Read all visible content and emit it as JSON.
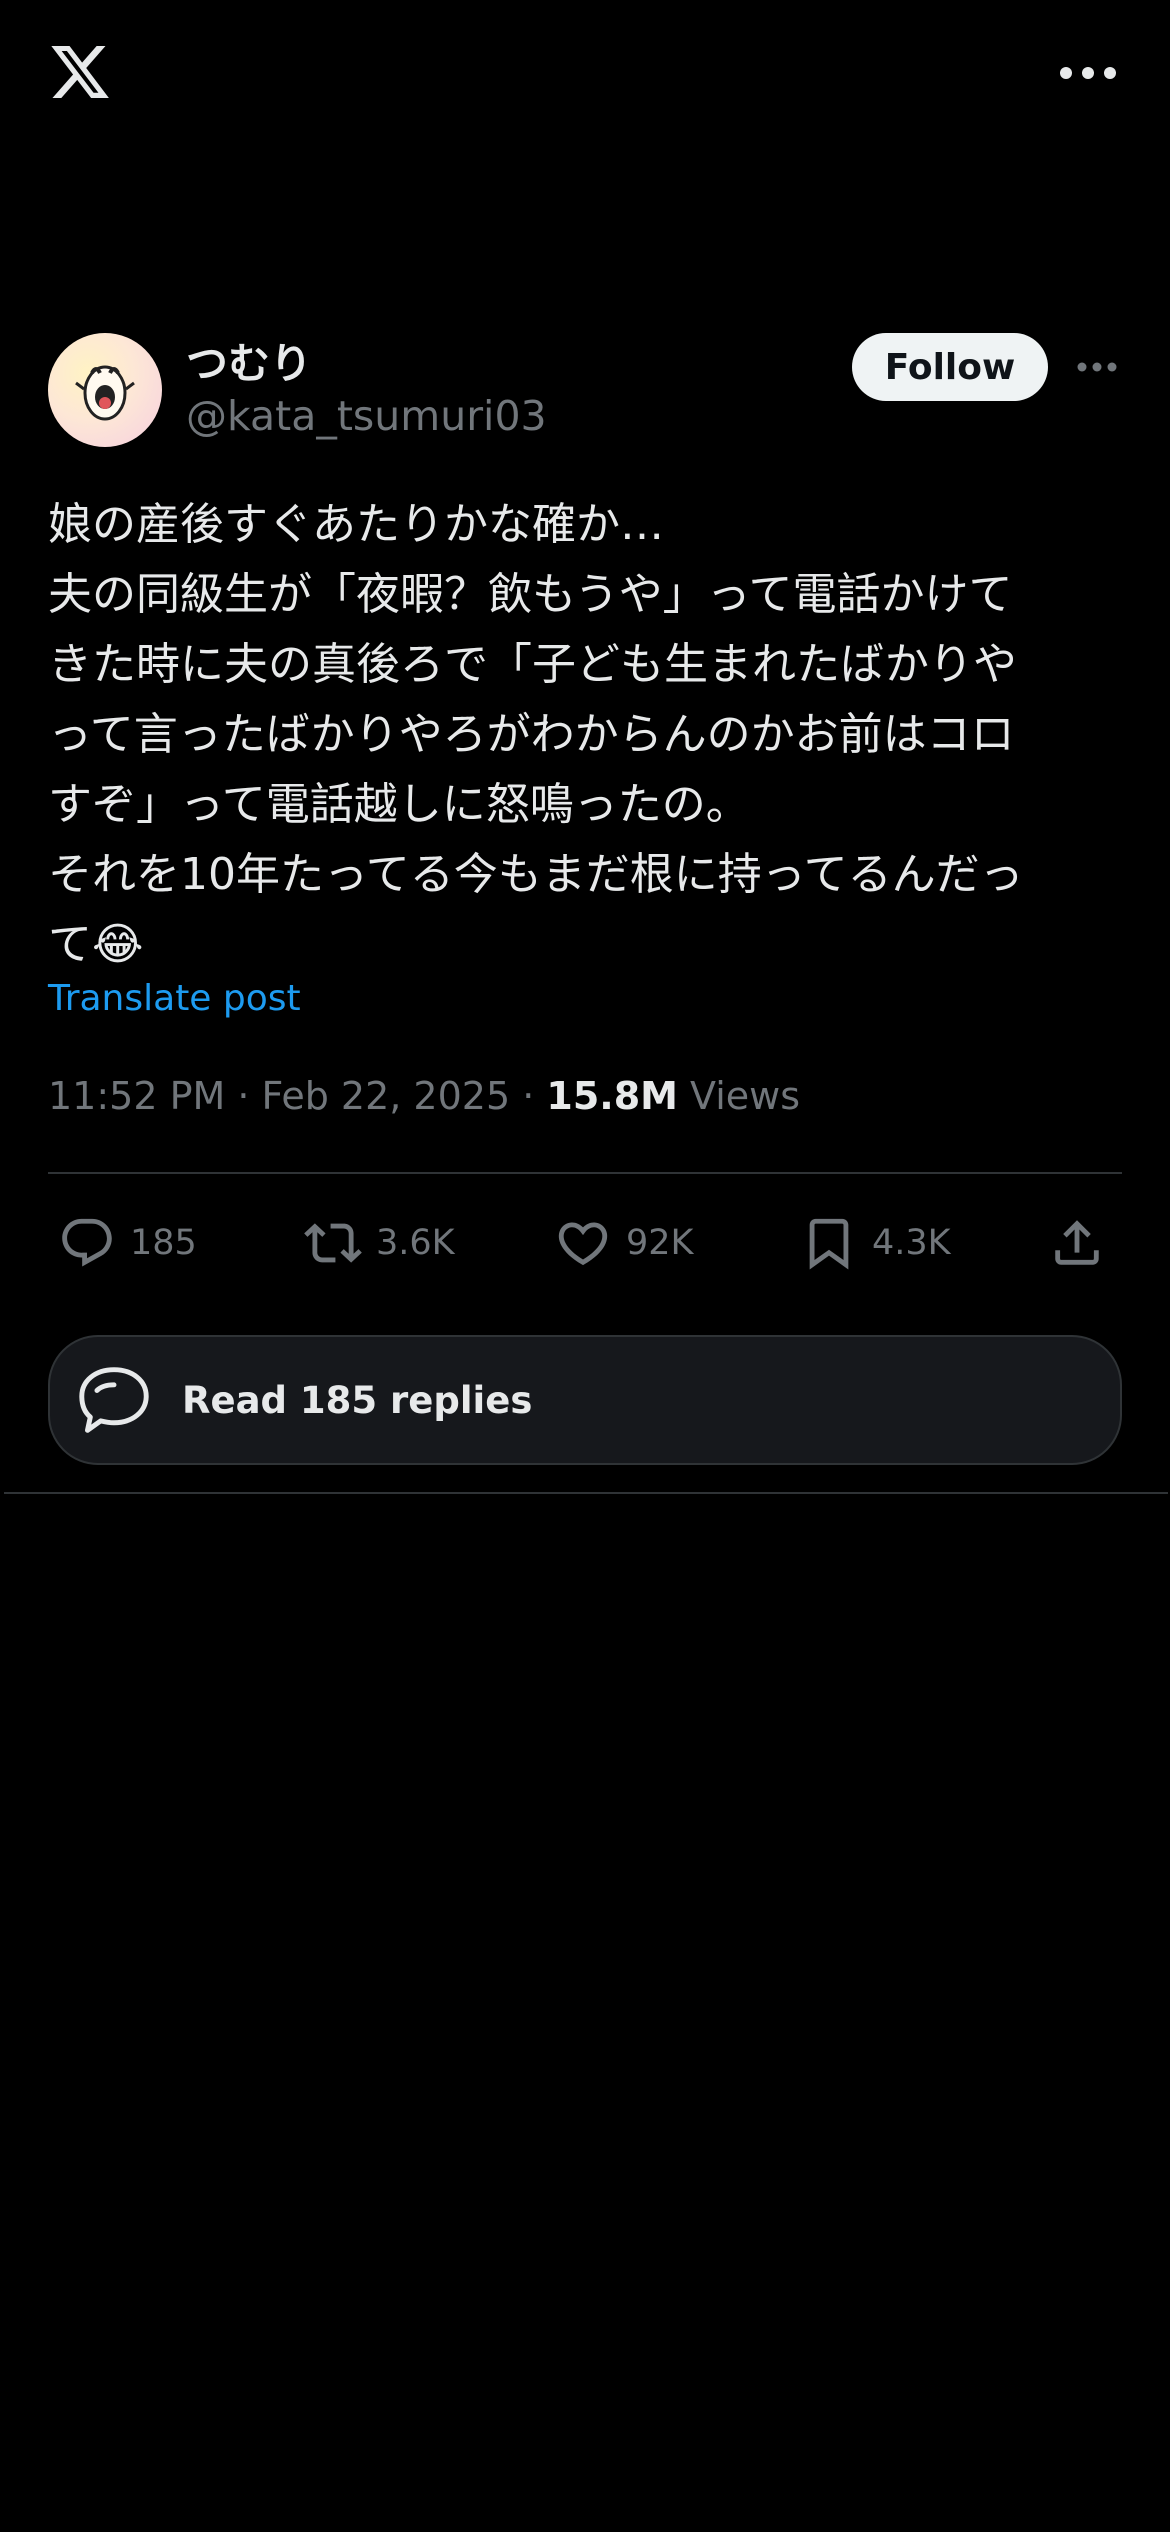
{
  "topbar": {
    "logo_icon": "x-logo-icon",
    "more_icon": "more-horizontal-icon"
  },
  "author": {
    "display_name": "つむり",
    "handle": "@kata_tsumuri03",
    "follow_label": "Follow",
    "more_icon": "more-horizontal-icon"
  },
  "tweet": {
    "lines": [
      "娘の産後すぐあたりかな確か…",
      "夫の同級生が「夜暇？飲もうや」って電話かけて",
      "きた時に夫の真後ろで「子ども生まれたばかりや",
      "って言ったばかりやろがわからんのかお前はコロ",
      "すぞ」って電話越しに怒鳴ったの。",
      "それを10年たってる今もまだ根に持ってるんだっ",
      "て😂"
    ],
    "translate_label": "Translate post"
  },
  "meta": {
    "time": "11:52 PM",
    "separator": " · ",
    "date": "Feb 22, 2025",
    "views_count": "15.8M",
    "views_label": "Views"
  },
  "actions": {
    "replies": {
      "icon": "reply-icon",
      "count": "185"
    },
    "reposts": {
      "icon": "repost-icon",
      "count": "3.6K"
    },
    "likes": {
      "icon": "heart-icon",
      "count": "92K"
    },
    "bookmarks": {
      "icon": "bookmark-icon",
      "count": "4.3K"
    },
    "share": {
      "icon": "share-icon"
    }
  },
  "read_replies": {
    "icon": "replies-bubble-icon",
    "label": "Read 185 replies"
  },
  "colors": {
    "background": "#000000",
    "text": "#e7e9ea",
    "secondary": "#71767b",
    "link": "#1d9bf0",
    "divider": "#2f3336",
    "follow_bg": "#eff3f4"
  }
}
